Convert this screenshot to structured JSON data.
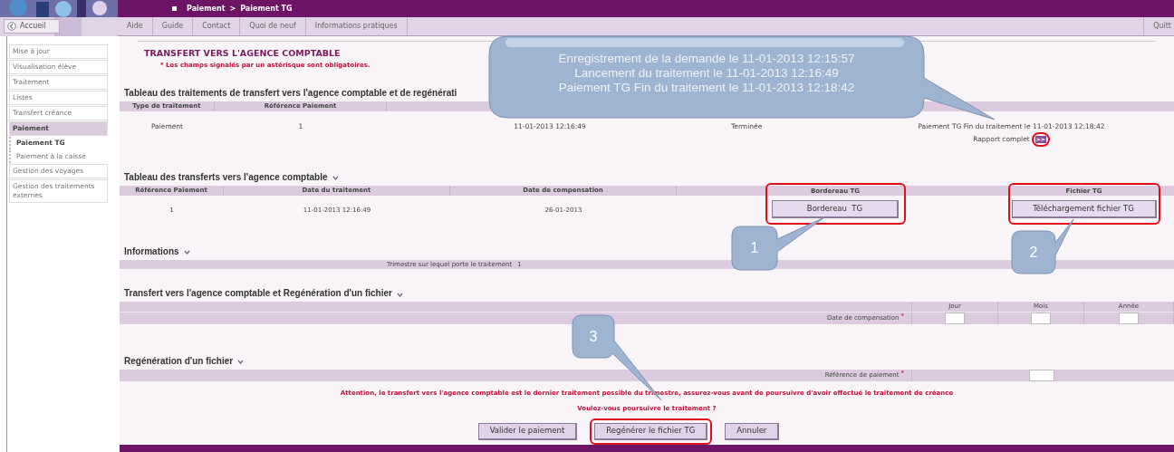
{
  "breadcrumb": {
    "items": [
      "Paiement",
      "Paiement TG"
    ],
    "separator": ">"
  },
  "home_button": "Accueil",
  "top_tabs": [
    "Aide",
    "Guide",
    "Contact",
    "Quoi de neuf",
    "Informations pratiques"
  ],
  "quit_link": "Quitt",
  "sidebar": [
    {
      "label": "Mise à jour",
      "selected": false
    },
    {
      "label": "Visualisation élève",
      "selected": false
    },
    {
      "label": "Traitement",
      "selected": false
    },
    {
      "label": "Listes",
      "selected": false
    },
    {
      "label": "Transfert créance",
      "selected": false
    },
    {
      "label": "Paiement",
      "selected": true,
      "children": [
        {
          "label": "Paiement TG",
          "selected": true
        },
        {
          "label": "Paiement à la caisse",
          "selected": false
        }
      ]
    },
    {
      "label": "Gestion des voyages",
      "selected": false
    },
    {
      "label": "Gestion des traitements externes",
      "selected": false
    }
  ],
  "page_title": "TRANSFERT VERS L'AGENCE COMPTABLE",
  "required_note": "* Les champs signalés par un astérisque sont obligatoires.",
  "processing_table": {
    "title": "Tableau des traitements de transfert vers l'agence comptable et de regénérati",
    "columns": [
      "Type de traitement",
      "Référence Paiement"
    ],
    "row": {
      "type": "Paiement",
      "reference": "1",
      "date": "11-01-2013 12:16:49",
      "status": "Terminée",
      "detail": "Paiement TG Fin du traitement le 11-01-2013 12:18:42",
      "report_label": "Rapport complet",
      "report_link": ">>"
    }
  },
  "transfers_table": {
    "title": "Tableau des transferts vers l'agence comptable",
    "columns": [
      "Référence Paiement",
      "Date du traitement",
      "Date de compensation",
      "Bordereau TG",
      "Fichier TG"
    ],
    "rows": [
      {
        "reference": "1",
        "date": "11-01-2013 12:16:49",
        "compensation_date": "26-01-2013",
        "slip_button": "Bordereau  TG",
        "file_button": "Téléchargement fichier TG"
      }
    ]
  },
  "informations": {
    "title": "Informations",
    "label": "Trimestre sur lequel porte le traitement",
    "value": "1"
  },
  "transfer_section": {
    "title": "Transfert vers l'agence comptable et Regénération d'un fichier",
    "date_label": "Date de compensation",
    "required_mark": "*",
    "fields": [
      "Jour",
      "Mois",
      "Année"
    ]
  },
  "regeneration_section": {
    "title": "Regénération d'un fichier",
    "label": "Référence de paiement",
    "required_mark": "*"
  },
  "warning": "Attention, le transfert vers l'agence comptable est le dernier traitement possible du trimestre, assurez-vous avant de poursuivre d'avoir effectué le traitement de créance",
  "question": "Voulez-vous poursuivre le traitement ?",
  "buttons": [
    "Valider le paiement",
    "Regénérer le fichier TG",
    "Annuler"
  ],
  "annotations": {
    "callout_lines": [
      "Enregistrement de la demande le 11-01-2013 12:15:57",
      "Lancement du traitement le 11-01-2013 12:16:49",
      "Paiement TG Fin du traitement le 11-01-2013 12:18:42"
    ],
    "markers": [
      "1",
      "2",
      "3"
    ]
  }
}
